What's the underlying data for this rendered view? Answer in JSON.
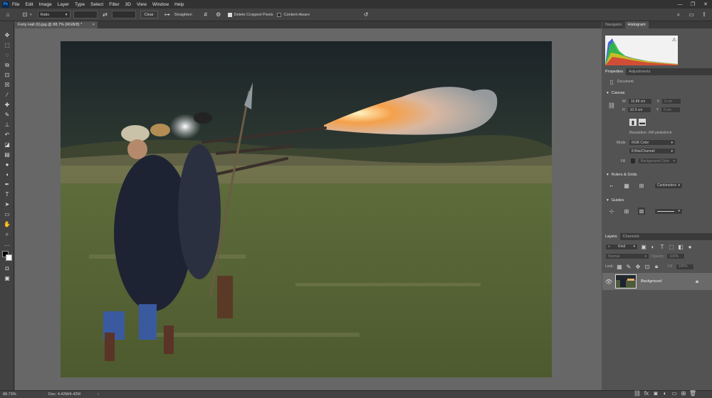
{
  "menu": {
    "logo": "Ps",
    "items": [
      "File",
      "Edit",
      "Image",
      "Layer",
      "Type",
      "Select",
      "Filter",
      "3D",
      "View",
      "Window",
      "Help"
    ],
    "window_controls": [
      "—",
      "❐",
      "✕"
    ]
  },
  "options": {
    "ratio_label": "Ratio",
    "clear_label": "Clear",
    "straighten_label": "Straighten",
    "delete_cropped_label": "Delete Cropped Pixels",
    "content_aware_label": "Content-Aware"
  },
  "document_tab": {
    "title": "Forty Hall (6).jpg @ 88.7% (RGB/8) *",
    "close": "×"
  },
  "status": {
    "zoom": "88.73%",
    "doc_info": "Doc: 4.42M/4.42M",
    "arrow": "›"
  },
  "panels": {
    "nav_tabs": [
      "Navigator",
      "Histogram"
    ],
    "prop_tabs": [
      "Properties",
      "Adjustments"
    ],
    "document_label": "Document",
    "canvas": {
      "heading": "Canvas",
      "w_label": "W",
      "w_value": "15.88 cm",
      "h_label": "H",
      "h_value": "10.9 cm",
      "x_label": "X",
      "x_value": "0 cm",
      "y_label": "Y",
      "y_value": "0 cm",
      "resolution": "Resolution: 240 pixels/inch",
      "mode_label": "Mode",
      "mode_value": "RGB Color",
      "depth_value": "8 Bits/Channel",
      "fill_label": "Fill",
      "fill_value": "Background Color"
    },
    "rulers": {
      "heading": "Rulers & Grids",
      "units": "Centimeters"
    },
    "guides": {
      "heading": "Guides"
    },
    "layers_tabs": [
      "Layers",
      "Channels"
    ],
    "layers": {
      "kind": "Kind",
      "blend": "Normal",
      "opacity_label": "Opacity:",
      "opacity_value": "100%",
      "lock_label": "Lock:",
      "fill_label": "Fill:",
      "fill_value": "100%",
      "layer_name": "Background"
    }
  }
}
